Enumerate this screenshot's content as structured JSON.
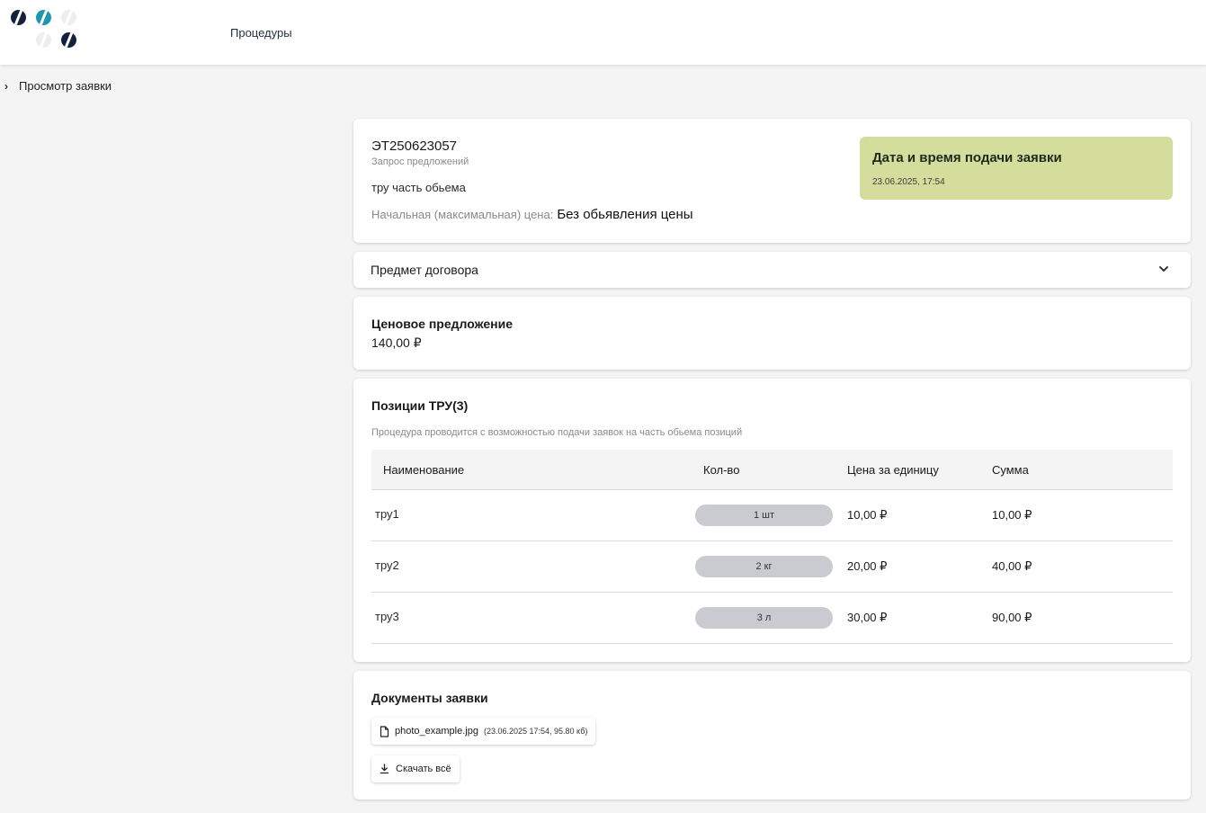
{
  "header": {
    "nav_link": "Процедуры",
    "logo_icon": "dots-logo-icon"
  },
  "breadcrumb": {
    "current": "Просмотр заявки"
  },
  "procedure": {
    "number": "ЭТ250623057",
    "type": "Запрос предложений",
    "name": "тру часть обьема",
    "price_label": "Начальная (максимальная) цена:",
    "price_value": "Без обьявления цены"
  },
  "submission": {
    "title": "Дата и время подачи заявки",
    "datetime": "23.06.2025, 17:54",
    "color": "#d5dd9c"
  },
  "subject": {
    "title": "Предмет договора"
  },
  "offer": {
    "title": "Ценовое предложение",
    "value": "140,00 ₽"
  },
  "items": {
    "title": "Позиции ТРУ(3)",
    "note": "Процедура проводится с возможностью подачи заявок на часть обьема позиций",
    "columns": {
      "name": "Наименование",
      "qty": "Кол-во",
      "unit_price": "Цена за единицу",
      "sum": "Сумма"
    },
    "rows": [
      {
        "name": "тру1",
        "qty": "1 шт",
        "unit_price": "10,00 ₽",
        "sum": "10,00 ₽"
      },
      {
        "name": "тру2",
        "qty": "2 кг",
        "unit_price": "20,00 ₽",
        "sum": "40,00 ₽"
      },
      {
        "name": "тру3",
        "qty": "3 л",
        "unit_price": "30,00 ₽",
        "sum": "90,00 ₽"
      }
    ]
  },
  "documents": {
    "title": "Документы заявки",
    "file_name": "photo_example.jpg",
    "file_meta": "(23.06.2025 17:54, 95.80 кб)",
    "download_all": "Скачать всё"
  }
}
